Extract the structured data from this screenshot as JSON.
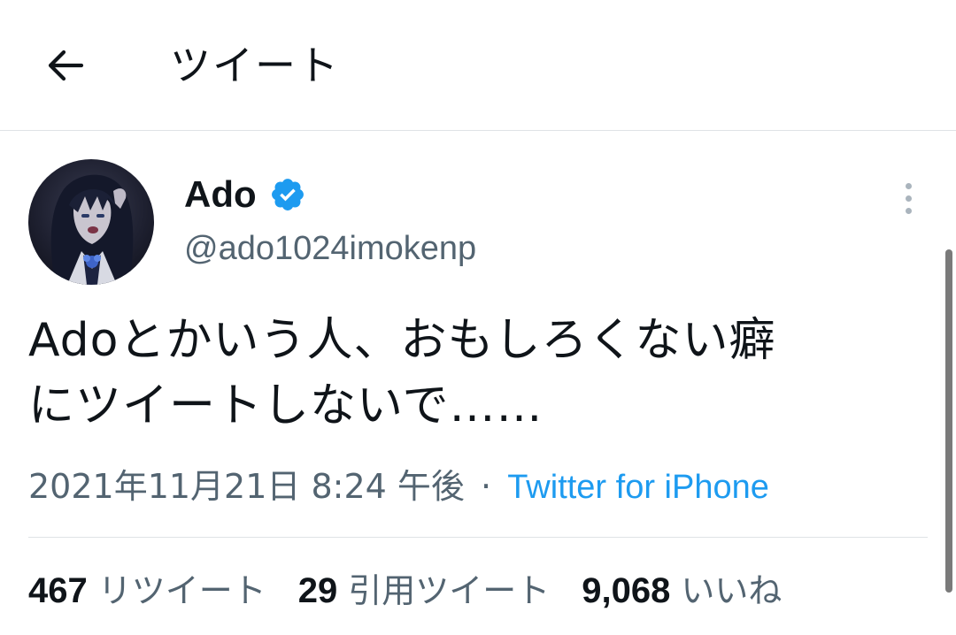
{
  "header": {
    "title": "ツイート",
    "back_icon": "arrow-left-icon"
  },
  "tweet": {
    "author": {
      "display_name": "Ado",
      "handle": "@ado1024imokenp",
      "verified_icon": "verified-badge-icon",
      "verified_color": "#1d9bf0"
    },
    "text_line1": "Adoとかいう人、おもしろくない癖",
    "text_line2": "にツイートしないで……",
    "timestamp": "2021年11月21日 8:24 午後",
    "separator": "·",
    "source": "Twitter for iPhone",
    "more_icon": "more-vertical-icon"
  },
  "stats": {
    "retweets_count": "467",
    "retweets_label": "リツイート",
    "quotes_count": "29",
    "quotes_label": "引用ツイート",
    "likes_count": "9,068",
    "likes_label": "いいね"
  },
  "colors": {
    "accent": "#1d9bf0",
    "text_primary": "#0f1419",
    "text_secondary": "#536471",
    "divider": "#dfe3e6"
  }
}
